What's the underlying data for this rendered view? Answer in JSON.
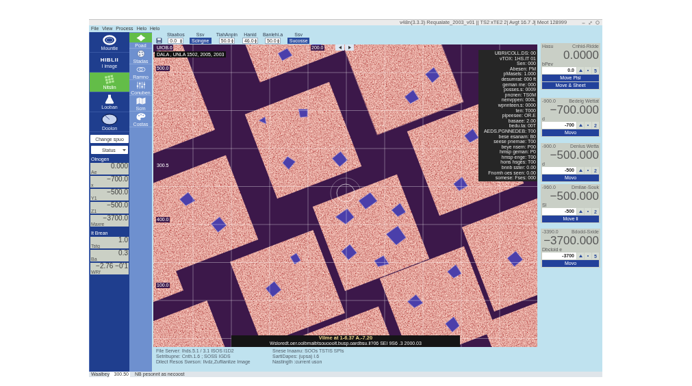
{
  "window": {
    "title": "v48n(3.3.3) Requalate_2003_v01  || TS2 xTE2 2| Avgt 16.7 J| Meot 128999"
  },
  "menu": [
    {
      "label": "File"
    },
    {
      "label": "View"
    },
    {
      "label": "Process"
    },
    {
      "label": "Helo"
    },
    {
      "label": "Helo"
    }
  ],
  "nav_sidebar": {
    "items": [
      {
        "label": "Mountle",
        "kind": "icon",
        "selected": false
      },
      {
        "label": "I image",
        "kind": "logo",
        "logo": "HIBLII",
        "selected": false
      },
      {
        "label": "Nitslin",
        "kind": "icon",
        "selected": true
      },
      {
        "label": "Looban",
        "kind": "icon",
        "selected": false
      },
      {
        "label": "Doolon",
        "kind": "icon",
        "selected": false
      }
    ],
    "change_button": "Change spuo",
    "status_select": "Status",
    "groups": [
      {
        "title": "Olnogen",
        "rows": [
          {
            "value": "0.000",
            "label": "Ae"
          },
          {
            "value": "−700.0",
            "label": "x"
          },
          {
            "value": "−500.0",
            "label": "Y1"
          },
          {
            "value": "−500.0",
            "label": "Z1"
          },
          {
            "value": "−3700.0",
            "label": "Maxre"
          }
        ]
      },
      {
        "title": "It Brean",
        "rows": [
          {
            "value": "1.0",
            "label": "Tstg"
          },
          {
            "value": "0.3",
            "label": "Ba"
          },
          {
            "value": "−2.76 −0'1",
            "label": "WRf"
          }
        ]
      }
    ]
  },
  "tool_sidebar": {
    "items": [
      {
        "label": "Poad",
        "selected": true
      },
      {
        "label": "Stadas",
        "selected": false
      },
      {
        "label": "Ramno",
        "selected": false
      },
      {
        "label": "Conuben",
        "selected": false
      },
      {
        "label": "Scm",
        "selected": false
      },
      {
        "label": "Costas",
        "selected": false
      }
    ]
  },
  "toolbar": {
    "items": [
      {
        "kind": "spin",
        "label": "Staabos",
        "value": "0.0"
      },
      {
        "kind": "button",
        "label": "Ssv",
        "text": "Scingne"
      },
      {
        "kind": "spin",
        "label": "TiahAnpin",
        "value": "50.0"
      },
      {
        "kind": "spin",
        "label": "Hanid",
        "value": "46.0"
      },
      {
        "kind": "spin",
        "label": "Banlehi.a",
        "value": "50.0"
      },
      {
        "kind": "button",
        "label": "Ssv",
        "text": "Sucosse"
      }
    ]
  },
  "viewer": {
    "title": "DALA , UNLA 1502, 2005, 2003",
    "x_labels": [
      "UIOB.6",
      "200.0"
    ],
    "y_labels": [
      "500.0",
      "300.5",
      "400.0",
      "100.0"
    ],
    "info_lines": [
      "UBRI/COLL.DS: 00",
      "vTOX: 1HS.IT 01",
      "Sen: 000",
      "Abesen: PM",
      "pMasels: 1.000",
      "desumrat: 000 ft",
      "geman me: 000",
      "posses.s: 0009",
      "pncnen: TS0M",
      "nenvppen: 000L",
      "wpnnteen.s: 0000",
      "ten: T000",
      "pipeesee: OR.E",
      "basaee: 2.00",
      "bedu.ta: 00T",
      "AEDS.PGNNEDEB: T00",
      "bese esanam: B0",
      "seese pnemae: T00",
      "beye nsem: P00",
      "hmsp geman: P0",
      "hmsp enge: T00",
      "hons hsges: T00",
      "bnnb sster: 0.00",
      "Fnomh oes seen: 0.00",
      "somese: Fses: 000"
    ],
    "caption": "Vilme at 1-6.37 A.-7.20",
    "caption_detail": "Wsloredt.oer.oolbmaibtsouooolt.busp.oardbsu.li?06  SEI 9S6 .3 2000.03"
  },
  "stage_panel": {
    "axes": [
      {
        "range": "Hasu",
        "name": "Cnhid-Ridde",
        "reading": "0.0000",
        "field_label": "bPev",
        "value": "0.0",
        "step": "5",
        "buttons": [
          "Move Pisi",
          "Move & Sheet"
        ]
      },
      {
        "range": "-900.0",
        "name": "Bedeig Wettat",
        "reading": "−700.000",
        "field_label": "d",
        "value": "-700",
        "step": "2",
        "buttons": [
          "Movo"
        ]
      },
      {
        "range": "-900.0",
        "name": "Denlus Wetta",
        "reading": "−500.000",
        "field_label": "d",
        "value": "-500",
        "step": "2",
        "buttons": [
          "Movo"
        ]
      },
      {
        "range": "-960.0",
        "name": "Dmilae-Souk",
        "reading": "−500.000",
        "field_label": "Sl",
        "value": "-500",
        "step": "2",
        "buttons": [
          "Move li"
        ]
      },
      {
        "range": "-3390.0",
        "name": "Bdodd-Sxide",
        "reading": "−3700.000",
        "field_label": "Dbcloid e",
        "value": "-3700",
        "step": "5",
        "buttons": [
          "Movo"
        ]
      }
    ]
  },
  "info": {
    "left": [
      "File Server: Ihds.5.1 / 3.1  ISOS I1D2",
      "Setribupne: Cnth.1.6 ; SOSS IGDS",
      "Dilect Resos Swrson: Ilvdz,Zuflianlize Image"
    ],
    "right": [
      "Snese Inaanu: SOOs TSTIS SPIs",
      "SartiDapes: (upsa) I.6",
      "Nastingth  :current uson"
    ]
  },
  "status_bar": {
    "label": "Waalbey",
    "value": "300.50",
    "message": "NB pesonnt as necoost"
  }
}
